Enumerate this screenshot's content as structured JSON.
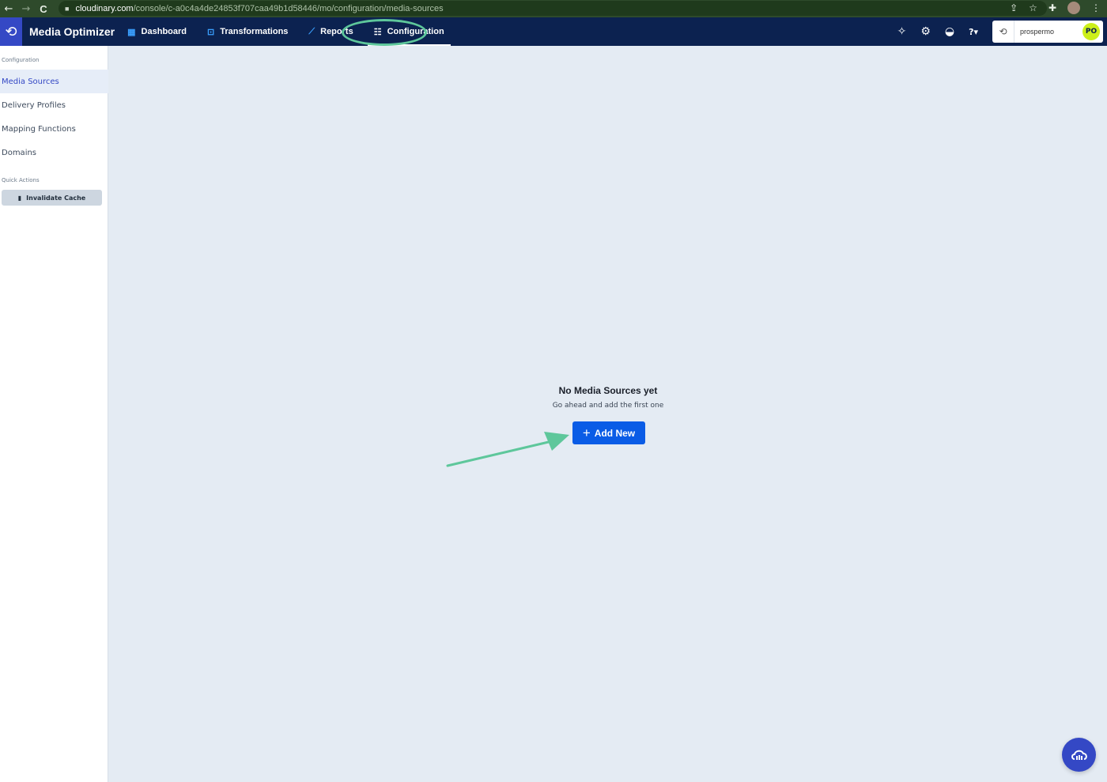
{
  "browser": {
    "back": "←",
    "forward": "→",
    "reload": "C",
    "lock": "🔒",
    "url_domain": "cloudinary.com",
    "url_path": "/console/c-a0c4a4de24853f707caa49b1d58446/mo/configuration/media-sources",
    "share": "⇪",
    "bookmark": "☆",
    "extensions": "✚",
    "menu": "⋮"
  },
  "topnav": {
    "logo": "⟲",
    "app_title": "Media Optimizer",
    "items": [
      {
        "label": "Dashboard",
        "icon": "▦"
      },
      {
        "label": "Transformations",
        "icon": "⊡"
      },
      {
        "label": "Reports",
        "icon": "⟋"
      },
      {
        "label": "Configuration",
        "icon": "☷"
      }
    ],
    "right_icons": {
      "bulb": "💡",
      "settings": "⚙",
      "academy": "🎓",
      "help": "?▾"
    },
    "account": {
      "name": "prospermo",
      "initials": "PO",
      "icon": "⟲"
    }
  },
  "sidebar": {
    "section_label": "Configuration",
    "items": [
      {
        "label": "Media Sources",
        "active": true
      },
      {
        "label": "Delivery Profiles",
        "active": false
      },
      {
        "label": "Mapping Functions",
        "active": false
      },
      {
        "label": "Domains",
        "active": false
      }
    ],
    "quick_actions_label": "Quick Actions",
    "invalidate_cache_label": "Invalidate Cache",
    "trash_icon": "🗑"
  },
  "main": {
    "empty_title": "No Media Sources yet",
    "empty_subtitle": "Go ahead and add the first one",
    "add_button_label": "Add New",
    "add_button_icon": "+"
  },
  "colors": {
    "nav_bg": "#0c2250",
    "brand": "#3448c5",
    "primary_button": "#0a5ce6",
    "highlight_annotation": "#5ec79b",
    "avatar_bg": "#ccef1a"
  }
}
